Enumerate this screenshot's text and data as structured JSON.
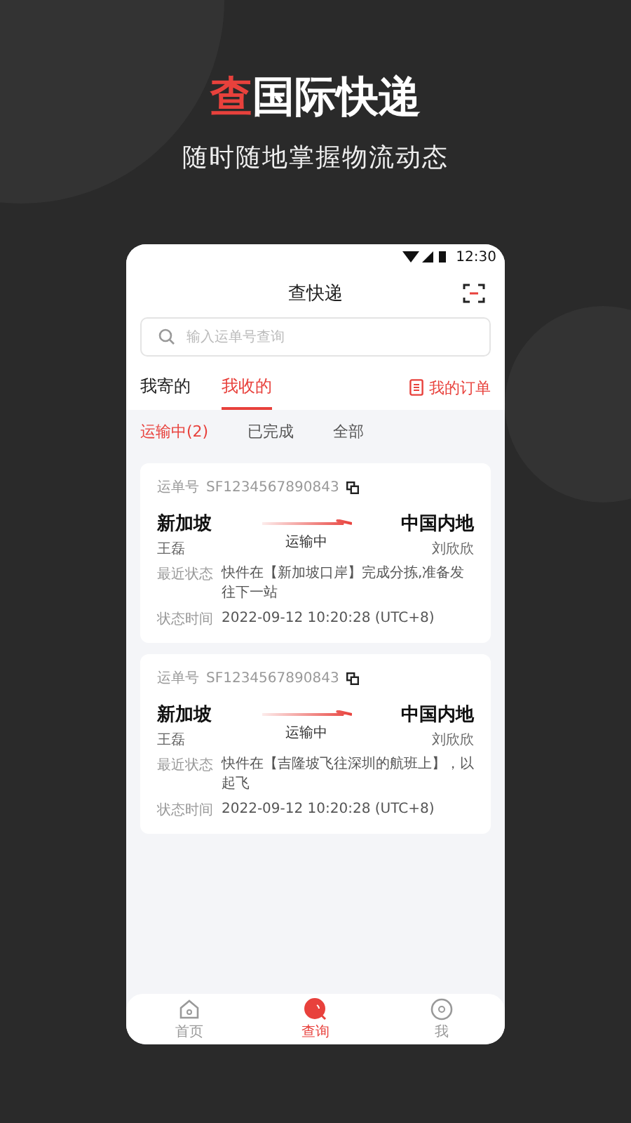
{
  "headline": {
    "accent": "查",
    "rest": "国际快递"
  },
  "subtitle": "随时随地掌握物流动态",
  "status_bar": {
    "time": "12:30"
  },
  "app_title": "查快递",
  "search": {
    "placeholder": "输入运单号查询"
  },
  "tabs": [
    {
      "label": "我寄的",
      "selected": false
    },
    {
      "label": "我收的",
      "selected": true
    }
  ],
  "orders_link": "我的订单",
  "filters": [
    {
      "label": "运输中(2)",
      "selected": true
    },
    {
      "label": "已完成",
      "selected": false
    },
    {
      "label": "全部",
      "selected": false
    }
  ],
  "shipments": [
    {
      "number_label": "运单号",
      "number": "SF1234567890843",
      "origin": "新加坡",
      "sender": "王磊",
      "status": "运输中",
      "destination": "中国内地",
      "receiver": "刘欣欣",
      "latest_label": "最近状态",
      "latest": "快件在【新加坡口岸】完成分拣,准备发往下一站",
      "time_label": "状态时间",
      "time": "2022-09-12 10:20:28 (UTC+8)"
    },
    {
      "number_label": "运单号",
      "number": "SF1234567890843",
      "origin": "新加坡",
      "sender": "王磊",
      "status": "运输中",
      "destination": "中国内地",
      "receiver": "刘欣欣",
      "latest_label": "最近状态",
      "latest": "快件在【吉隆坡飞往深圳的航班上】，以起飞",
      "time_label": "状态时间",
      "time": "2022-09-12 10:20:28 (UTC+8)"
    }
  ],
  "nav": [
    {
      "label": "首页",
      "kind": "home",
      "selected": false
    },
    {
      "label": "查询",
      "kind": "search",
      "selected": true
    },
    {
      "label": "我",
      "kind": "me",
      "selected": false
    }
  ]
}
